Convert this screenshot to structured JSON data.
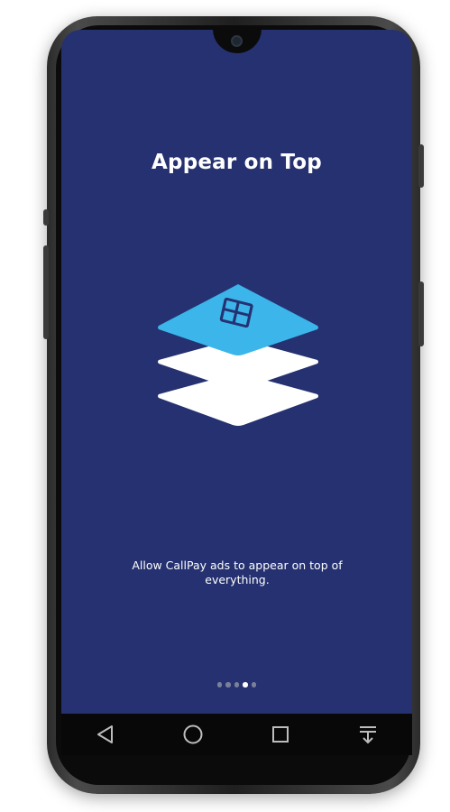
{
  "screen": {
    "title": "Appear on Top",
    "description": "Allow CallPay ads to appear on top of everything.",
    "background_color": "#253170"
  },
  "illustration": {
    "icon": "layers-icon",
    "top_layer_color": "#3bb5ea",
    "layer_color": "#ffffff"
  },
  "pager": {
    "total_pages": 5,
    "active_page": 4
  },
  "navigation_bar": {
    "buttons": [
      "back-icon",
      "home-icon",
      "recents-icon",
      "notification-pulldown-icon"
    ]
  }
}
